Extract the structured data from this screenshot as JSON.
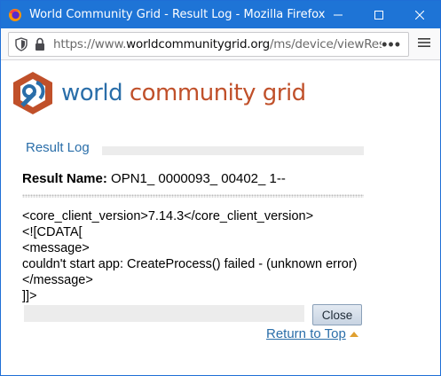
{
  "window": {
    "title": "World Community Grid - Result Log - Mozilla Firefox",
    "app_icon": "firefox-icon",
    "controls": [
      "minimize-icon",
      "maximize-icon",
      "close-icon"
    ],
    "accent_color": "#1e74d6"
  },
  "toolbar": {
    "url_prefix": "https://www.",
    "url_domain": "worldcommunitygrid.org",
    "url_path": "/ms/device/viewResult",
    "page_actions": "•••",
    "menu_icon": "hamburger-menu-icon"
  },
  "page": {
    "brand": {
      "word1": "world",
      "word2": "community",
      "word3": "grid",
      "blue": "#2a6ea9",
      "orange": "#c0502a"
    },
    "section_title": "Result Log",
    "result_name_label": "Result Name:",
    "result_name_value": "OPN1_ 0000093_ 00402_ 1--",
    "log_text": "<core_client_version>7.14.3</core_client_version>\n<![CDATA[\n<message>\ncouldn't start app: CreateProcess() failed - (unknown error)</message>\n]]>",
    "close_label": "Close",
    "return_top_label": "Return to Top"
  }
}
